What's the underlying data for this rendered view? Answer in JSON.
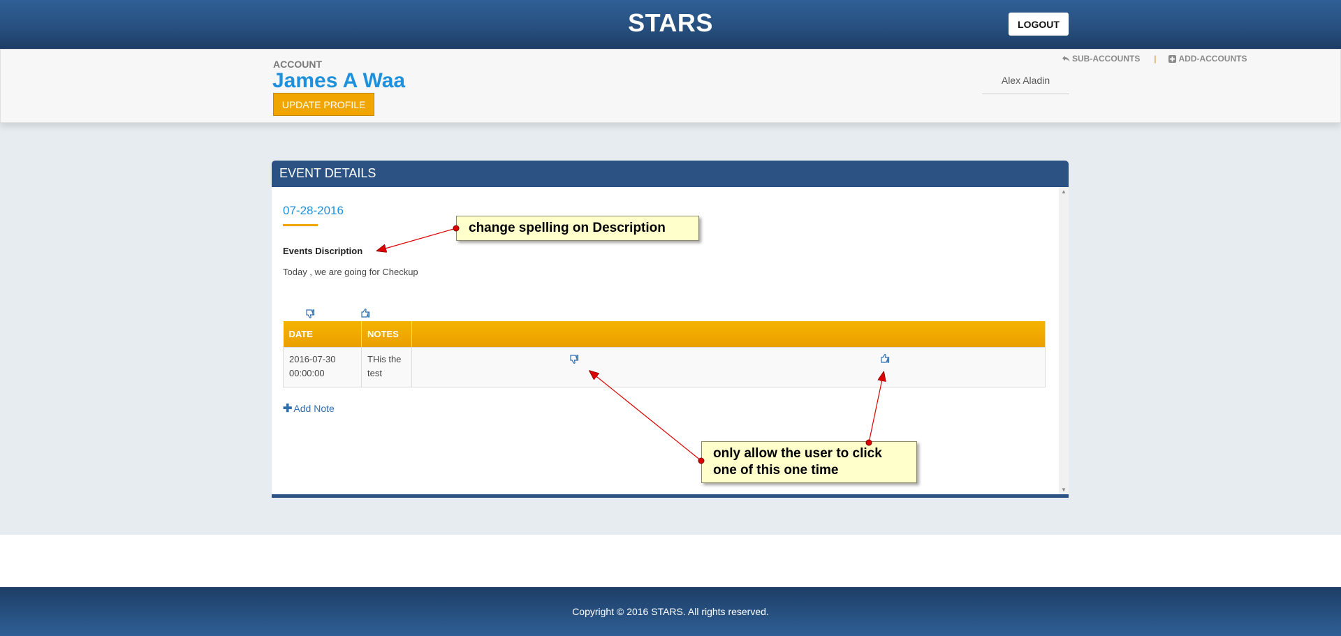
{
  "header": {
    "brand": "STARS",
    "logout_label": "LOGOUT"
  },
  "account": {
    "label": "ACCOUNT",
    "name": "James A Waa",
    "update_profile_label": "UPDATE PROFILE",
    "links": {
      "sub_accounts": "SUB-ACCOUNTS",
      "separator": "|",
      "add_accounts": "ADD-ACCOUNTS"
    },
    "user": "Alex Aladin"
  },
  "event": {
    "panel_title": "EVENT DETAILS",
    "date": "07-28-2016",
    "description_title": "Events Discription",
    "description_text": "Today , we are going for Checkup",
    "table": {
      "headers": [
        "DATE",
        "NOTES",
        ""
      ],
      "rows": [
        {
          "date_line1": "2016-07-30",
          "date_line2": "00:00:00",
          "notes_line1": "THis the",
          "notes_line2": "test"
        }
      ]
    },
    "add_note_label": "Add Note"
  },
  "annotations": {
    "callout_1": "change spelling on Description",
    "callout_2_line1": "only allow the user to click",
    "callout_2_line2": "one of this one time"
  },
  "footer": {
    "copyright": "Copyright © 2016 STARS. All rights reserved."
  },
  "colors": {
    "header_blue": "#2c5283",
    "accent_orange": "#f0a500",
    "link_blue": "#1e90dc",
    "callout_yellow": "#ffffcc",
    "arrow_red": "#dd0000"
  },
  "icons": [
    "reply-icon",
    "plus-square-icon",
    "thumbs-down-icon",
    "thumbs-up-icon",
    "plus-icon"
  ]
}
